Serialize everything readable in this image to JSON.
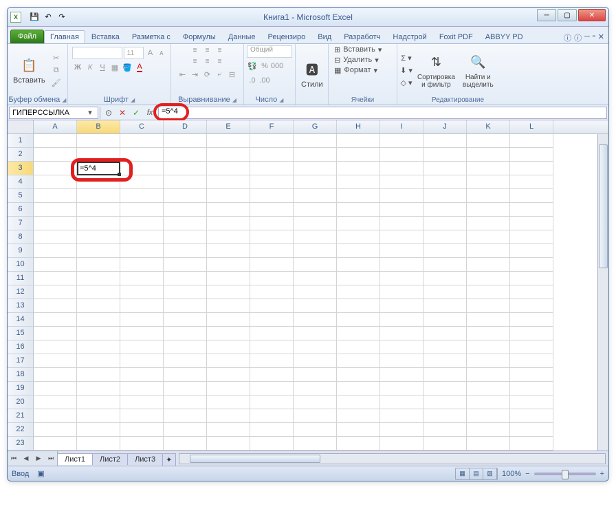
{
  "titlebar": {
    "title": "Книга1 - Microsoft Excel"
  },
  "qat": {
    "save": "💾",
    "undo": "↶",
    "redo": "↷"
  },
  "tabs": {
    "file": "Файл",
    "home": "Главная",
    "insert": "Вставка",
    "layout": "Разметка с",
    "formulas": "Формулы",
    "data": "Данные",
    "review": "Рецензиро",
    "view": "Вид",
    "developer": "Разработч",
    "addins": "Надстрой",
    "foxit": "Foxit PDF",
    "abbyy": "ABBYY PD"
  },
  "ribbon": {
    "clipboard": {
      "paste": "Вставить",
      "label": "Буфер обмена"
    },
    "font": {
      "name": "",
      "size": "11",
      "label": "Шрифт"
    },
    "align": {
      "label": "Выравнивание"
    },
    "number": {
      "format": "Общий",
      "label": "Число"
    },
    "styles": {
      "btn": "Стили"
    },
    "cells": {
      "insert": "Вставить",
      "delete": "Удалить",
      "format": "Формат",
      "label": "Ячейки"
    },
    "editing": {
      "sort": "Сортировка\nи фильтр",
      "find": "Найти и\nвыделить",
      "label": "Редактирование"
    }
  },
  "formula_bar": {
    "name_box": "ГИПЕРССЫЛКА",
    "formula": "=5^4"
  },
  "grid": {
    "columns": [
      "A",
      "B",
      "C",
      "D",
      "E",
      "F",
      "G",
      "H",
      "I",
      "J",
      "K",
      "L"
    ],
    "rows": [
      "1",
      "2",
      "3",
      "4",
      "5",
      "6",
      "7",
      "8",
      "9",
      "10",
      "11",
      "12",
      "13",
      "14",
      "15",
      "16",
      "17",
      "18",
      "19",
      "20",
      "21",
      "22",
      "23"
    ],
    "active_col": "B",
    "active_row": "3",
    "edit_cell": {
      "col": 1,
      "row": 2,
      "value": "=5^4"
    }
  },
  "sheets": {
    "s1": "Лист1",
    "s2": "Лист2",
    "s3": "Лист3"
  },
  "status": {
    "mode": "Ввод",
    "zoom": "100%"
  }
}
